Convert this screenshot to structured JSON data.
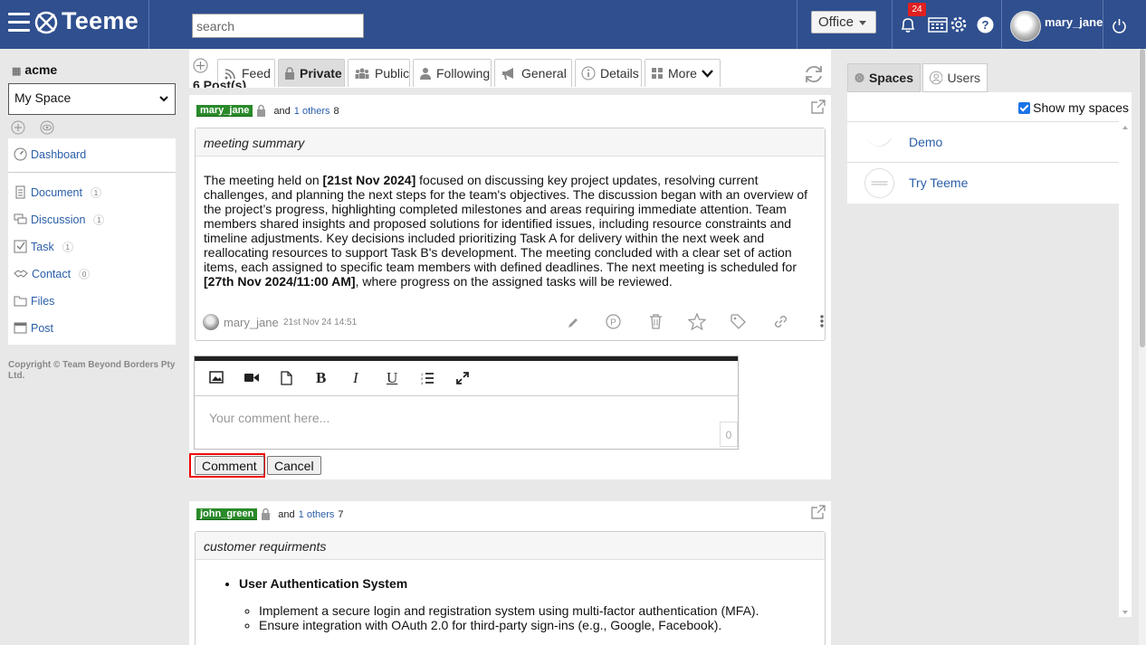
{
  "app": {
    "logo_text": "Teeme",
    "search_placeholder": "search",
    "workspace_selector": "Office",
    "notification_count": "24",
    "username": "mary_jane"
  },
  "sidebar": {
    "org_name": "acme",
    "space_select": "My Space",
    "items": [
      {
        "label": "Dashboard",
        "icon": "dashboard-icon",
        "count": ""
      },
      {
        "label": "Document",
        "icon": "document-icon",
        "count": "1"
      },
      {
        "label": "Discussion",
        "icon": "discussion-icon",
        "count": "1"
      },
      {
        "label": "Task",
        "icon": "task-icon",
        "count": "1"
      },
      {
        "label": "Contact",
        "icon": "contact-icon",
        "count": "0"
      },
      {
        "label": "Files",
        "icon": "folder-icon",
        "count": ""
      },
      {
        "label": "Post",
        "icon": "post-icon",
        "count": ""
      }
    ],
    "copyright": "Copyright © Team Beyond Borders Pty Ltd."
  },
  "tabs": [
    {
      "label": "Feed",
      "active": false
    },
    {
      "label": "Private",
      "active": true
    },
    {
      "label": "Public",
      "active": false
    },
    {
      "label": "Following",
      "active": false
    },
    {
      "label": "General",
      "active": false
    },
    {
      "label": "Details",
      "active": false
    },
    {
      "label": "More",
      "active": false
    }
  ],
  "posts_count_label": "6 Post(s)",
  "posts": [
    {
      "user": "mary_jane",
      "and_text": "and",
      "others_link": "1 others",
      "others_count": "8",
      "title": "meeting summary",
      "body_pre1": "The meeting held on ",
      "body_bold1": "[21st Nov 2024]",
      "body_mid": " focused on discussing key project updates, resolving current challenges, and planning the next steps for the team's objectives. The discussion began with an overview of the project’s progress, highlighting completed milestones and areas requiring immediate attention. Team members shared insights and proposed solutions for identified issues, including resource constraints and timeline adjustments. Key decisions included prioritizing Task A for delivery within the next week and reallocating resources to support Task B's development. The meeting concluded with a clear set of action items, each assigned to specific team members with defined deadlines. The next meeting is scheduled for ",
      "body_bold2": "[27th Nov 2024/11:00 AM]",
      "body_post": ", where progress on the assigned tasks will be reviewed.",
      "author": "mary_jane",
      "timestamp": "21st Nov 24 14:51"
    },
    {
      "user": "john_green",
      "and_text": "and",
      "others_link": "1 others",
      "others_count": "7",
      "title": "customer requirments",
      "bullet_heading": "User Authentication System",
      "sub_bullets": [
        "Implement a secure login and registration system using multi-factor authentication (MFA).",
        "Ensure integration with OAuth 2.0 for third-party sign-ins (e.g., Google, Facebook)."
      ]
    }
  ],
  "editor": {
    "placeholder": "Your comment here...",
    "char_count": "0",
    "comment_button": "Comment",
    "cancel_button": "Cancel"
  },
  "right_panel": {
    "tabs": [
      {
        "label": "Spaces",
        "active": true
      },
      {
        "label": "Users",
        "active": false
      }
    ],
    "show_my_spaces_label": "Show my spaces",
    "show_my_spaces_checked": true,
    "spaces": [
      {
        "name": "Demo"
      },
      {
        "name": "Try Teeme"
      }
    ]
  },
  "colors": {
    "topbar": "#2f4f8f",
    "user_tag": "#2a8a2a",
    "link": "#2a5ea8",
    "badge": "#e02020",
    "highlight": "#ee0000"
  }
}
